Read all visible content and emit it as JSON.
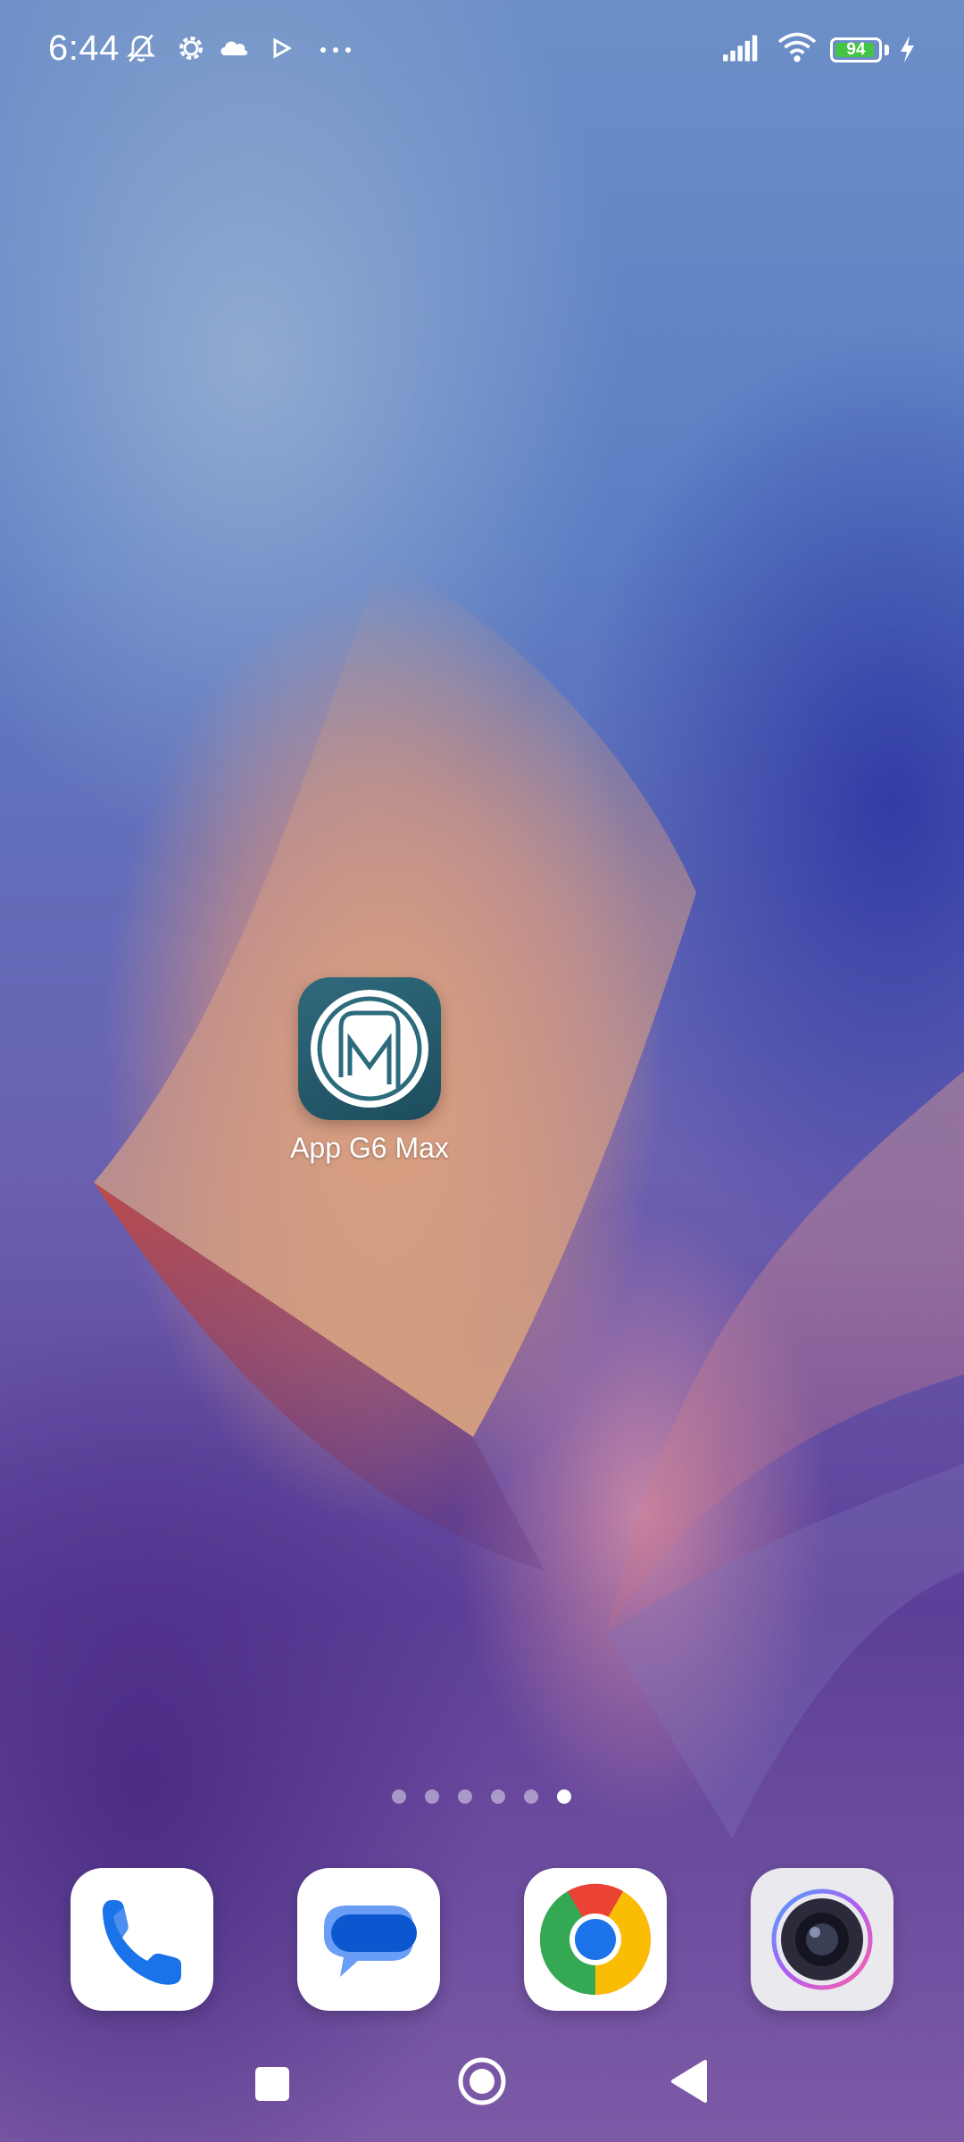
{
  "status_bar": {
    "time": "6:44",
    "icons": [
      "bell-off-icon",
      "gear-icon",
      "cloud-icon",
      "play-store-icon",
      "more-dots-icon",
      "signal-icon",
      "wifi-icon",
      "battery-icon",
      "charging-bolt-icon"
    ],
    "battery_level": "94",
    "battery_color": "#44c443"
  },
  "home": {
    "app": {
      "label": "App G6 Max",
      "icon": "m-logo-icon",
      "icon_color": "#1d4d5d"
    }
  },
  "pager": {
    "pages": 6,
    "current": 6
  },
  "dock": {
    "apps": [
      {
        "name": "Phone",
        "icon": "phone-icon",
        "color": "#1a73e8"
      },
      {
        "name": "Messages",
        "icon": "messages-icon",
        "color": "#0b57d0"
      },
      {
        "name": "Chrome",
        "icon": "chrome-icon",
        "color": "#ea4335"
      },
      {
        "name": "Camera",
        "icon": "camera-icon",
        "color": "#2a2a3a"
      }
    ]
  },
  "nav_bar": {
    "buttons": [
      "recents-button",
      "home-button",
      "back-button"
    ]
  }
}
